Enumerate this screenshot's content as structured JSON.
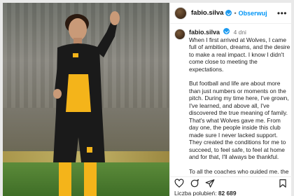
{
  "post": {
    "username": "fabio.silva",
    "separator": "•",
    "follow_label": "Obserwuj",
    "more_label": "•••",
    "time_ago": "4 dni",
    "caption_paragraphs": [
      "When I first arrived at Wolves, I came full of ambition, dreams, and the desire to make a real impact. I know I didn't come close to meeting the expectations.",
      "But football and life are about more than just numbers or moments on the pitch. During my time here, I've grown, I've learned, and above all, I've discovered the true meaning of family. That's what Wolves gave me. From day one, the people inside this club made sure I never lacked support. They created the conditions for me to succeed, to feel safe, to feel at home and for that, I'll always be thankful.",
      "To all the coaches who guided me, the teammates who stood beside me, and every member of staff who"
    ],
    "likes_label": "Liczba polubień:",
    "likes_count": "82 689"
  },
  "icons": {
    "verified": "verified-badge-icon",
    "like": "heart-icon",
    "comment": "comment-icon",
    "share": "share-icon",
    "save": "bookmark-icon"
  },
  "colors": {
    "link_blue": "#0095f6",
    "verified_blue": "#1d9bf0",
    "kit_gold": "#f4b41a",
    "kit_black": "#1a1a1a"
  }
}
